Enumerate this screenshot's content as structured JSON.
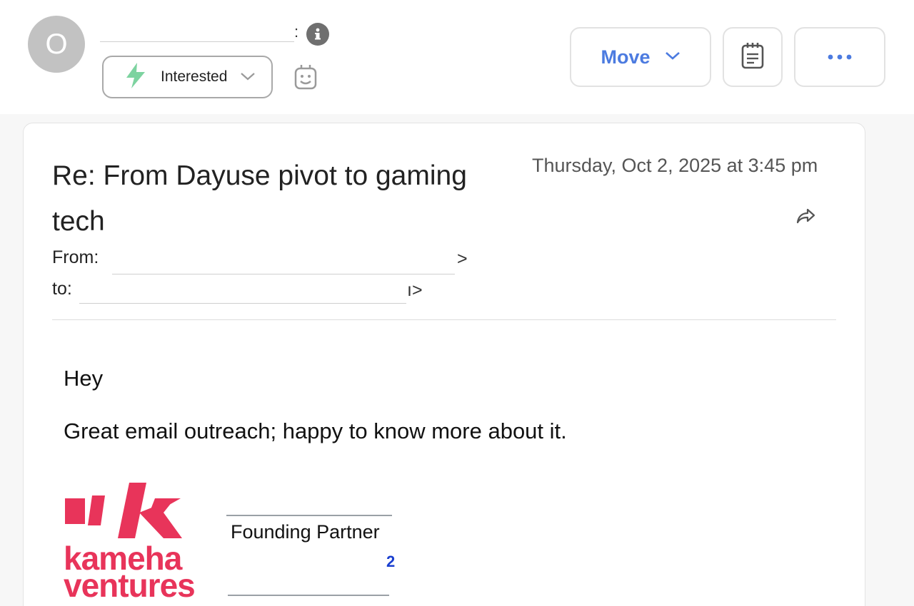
{
  "header": {
    "avatar_initial": "O",
    "contact_separator": ":",
    "status_label": "Interested",
    "move_label": "Move"
  },
  "email": {
    "subject": "Re: From Dayuse pivot to gaming tech",
    "date": "Thursday, Oct 2, 2025 at 3:45 pm",
    "from_label": "From:",
    "from_trailing": ">",
    "to_label": "to:",
    "to_trailing": "ı>",
    "greeting": "Hey",
    "body": "Great email outreach; happy to know more about it."
  },
  "signature": {
    "logo_line1": "kameha",
    "logo_line2": "ventures",
    "title": "Founding Partner",
    "link_fragment": "2"
  },
  "colors": {
    "accent_blue": "#4c7be0",
    "interested_green": "#7dd3a0",
    "brand_pink": "#e8345a"
  }
}
